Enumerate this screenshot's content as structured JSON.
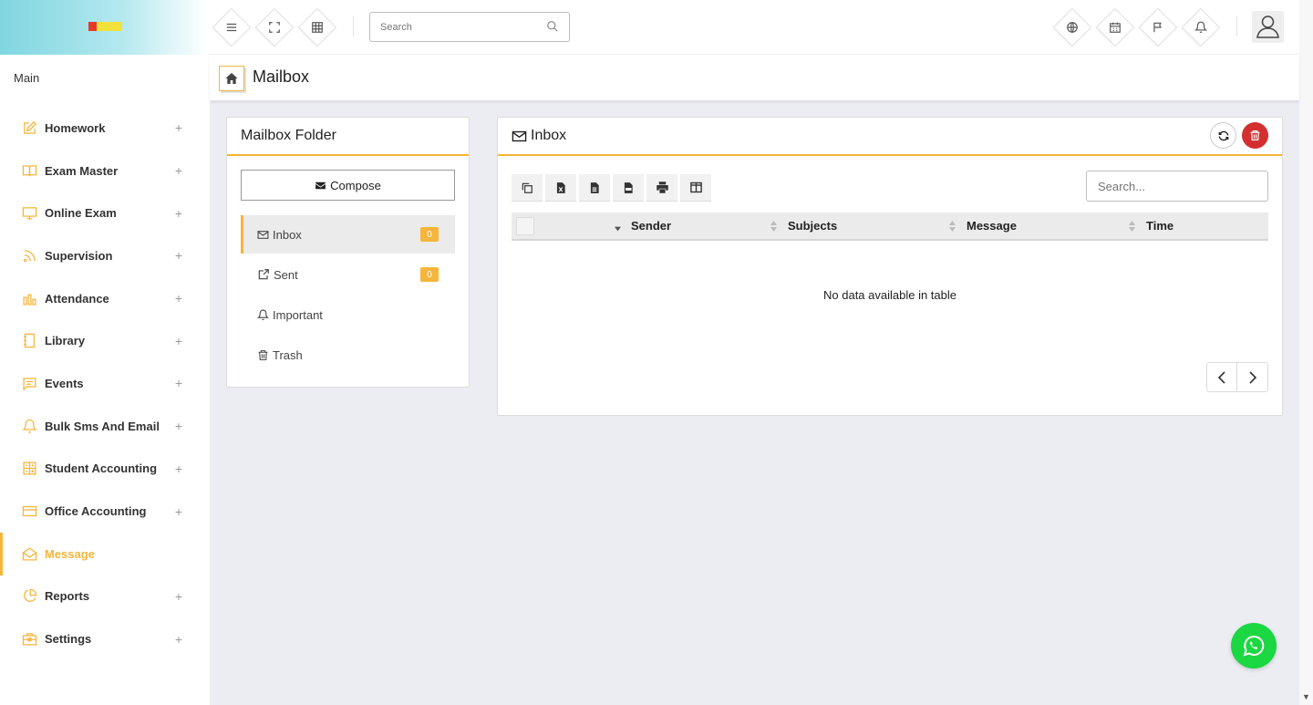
{
  "topbar": {
    "search_placeholder": "Search",
    "left_icons": [
      "menu-icon",
      "fullscreen-icon",
      "grid-icon"
    ],
    "right_icons": [
      "globe-icon",
      "calendar-icon",
      "flag-icon",
      "bell-icon"
    ]
  },
  "sidebar": {
    "section_label": "Main",
    "items": [
      {
        "label": "Homework",
        "icon": "edit-icon",
        "expandable": true
      },
      {
        "label": "Exam Master",
        "icon": "book-icon",
        "expandable": true
      },
      {
        "label": "Online Exam",
        "icon": "monitor-icon",
        "expandable": true
      },
      {
        "label": "Supervision",
        "icon": "rss-icon",
        "expandable": true
      },
      {
        "label": "Attendance",
        "icon": "bar-chart-icon",
        "expandable": true
      },
      {
        "label": "Library",
        "icon": "notebook-icon",
        "expandable": true
      },
      {
        "label": "Events",
        "icon": "message-icon",
        "expandable": true
      },
      {
        "label": "Bulk Sms And Email",
        "icon": "bell-icon",
        "expandable": true
      },
      {
        "label": "Student Accounting",
        "icon": "calculator-icon",
        "expandable": true
      },
      {
        "label": "Office Accounting",
        "icon": "credit-card-icon",
        "expandable": true
      },
      {
        "label": "Message",
        "icon": "envelope-open-icon",
        "expandable": false,
        "active": true
      },
      {
        "label": "Reports",
        "icon": "pie-chart-icon",
        "expandable": true
      },
      {
        "label": "Settings",
        "icon": "briefcase-icon",
        "expandable": true
      }
    ],
    "plus_symbol": "+"
  },
  "page": {
    "title": "Mailbox"
  },
  "folder": {
    "title": "Mailbox Folder",
    "compose_label": "Compose",
    "items": [
      {
        "label": "Inbox",
        "count": "0",
        "active": true
      },
      {
        "label": "Sent",
        "count": "0"
      },
      {
        "label": "Important"
      },
      {
        "label": "Trash"
      }
    ]
  },
  "inbox": {
    "title": "Inbox",
    "search_placeholder": "Search...",
    "columns": [
      "Sender",
      "Subjects",
      "Message",
      "Time"
    ],
    "empty_text": "No data available in table",
    "export_tools": [
      "copy-icon",
      "excel-icon",
      "csv-icon",
      "pdf-icon",
      "print-icon",
      "columns-icon"
    ]
  },
  "colors": {
    "accent": "#f6b53b",
    "danger": "#d32f2f",
    "whatsapp": "#1bd741",
    "content_bg": "#ebedf2"
  }
}
